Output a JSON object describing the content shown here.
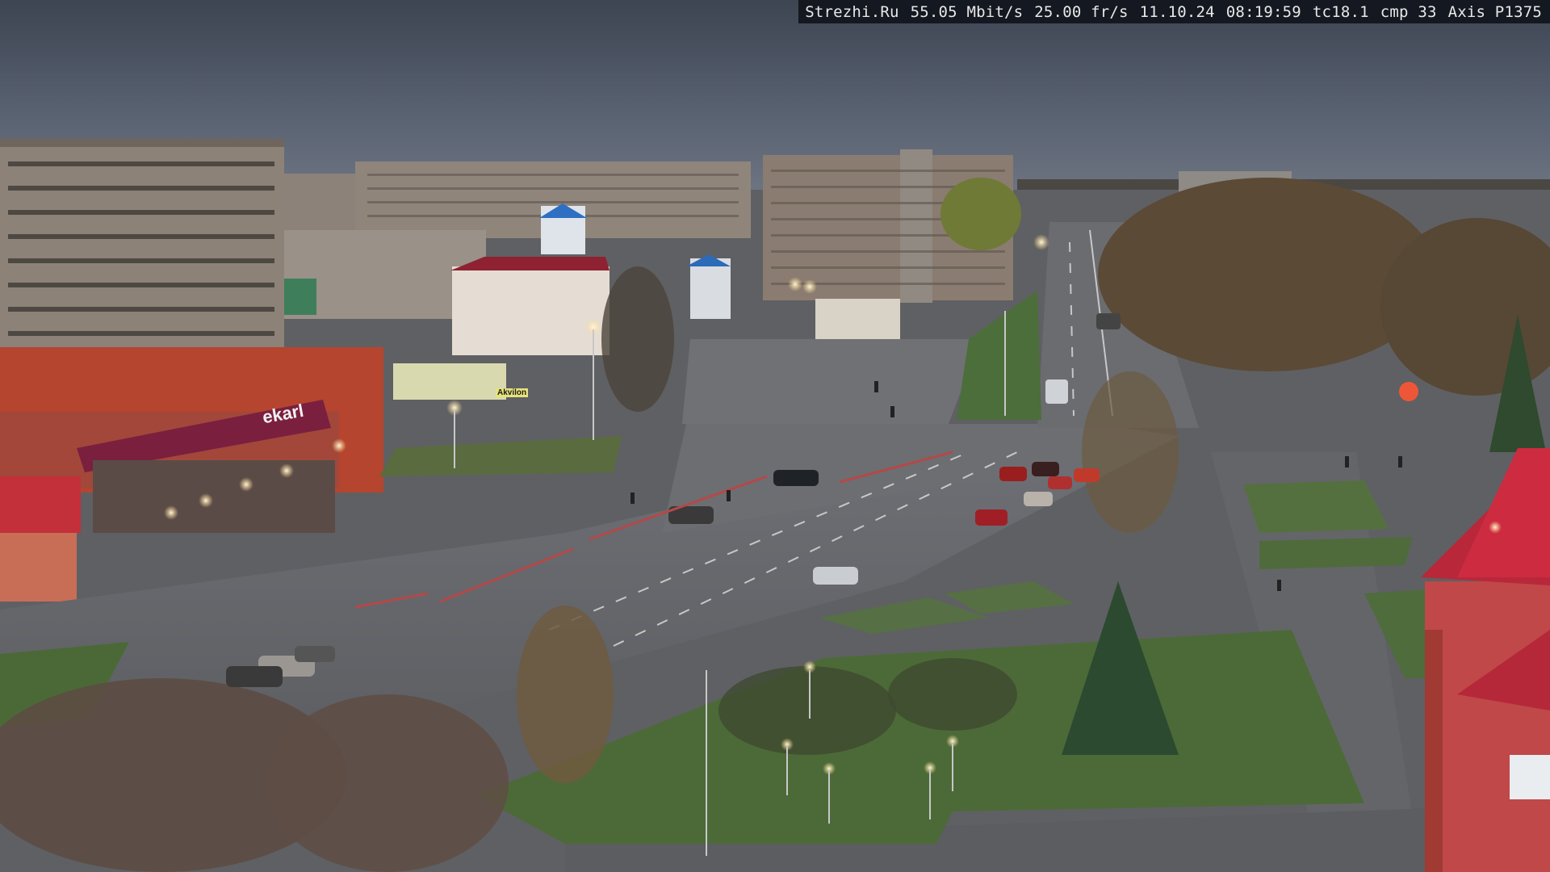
{
  "overlay": {
    "site": "Strezhi.Ru",
    "bitrate": "55.05 Mbit/s",
    "framerate": "25.00 fr/s",
    "date": "11.10.24",
    "time": "08:19:59",
    "tc": "tc18.1",
    "cmp": "cmp 33",
    "camera_model": "Axis P1375"
  },
  "scene": {
    "storefront_sign_1": "ekarl",
    "storefront_sign_2": "Akvilon"
  },
  "colors": {
    "sky": "#4a5260",
    "road": "#6d6f73",
    "grass": "#4d6a3a",
    "building_panel": "#8a7e74",
    "building_red": "#b03a2e",
    "roof_red": "#c22030"
  }
}
